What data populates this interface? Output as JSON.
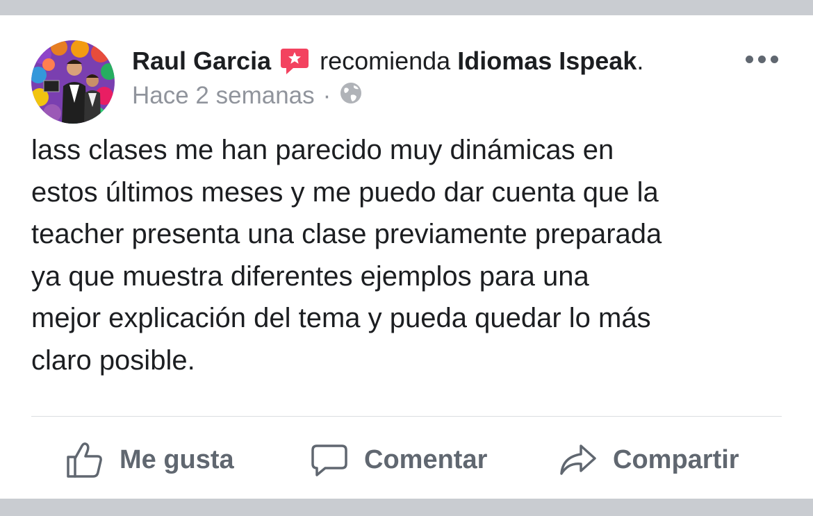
{
  "post": {
    "author": "Raul Garcia",
    "action_text": "recomienda",
    "page_name": "Idiomas Ispeak",
    "page_name_suffix": ".",
    "time_ago": "Hace 2 semanas",
    "separator": "·",
    "privacy_icon": "globe-icon",
    "recommend_icon": "recommendation-star-icon",
    "body": "lass clases me han parecido muy dinámicas en\nestos últimos meses y me puedo dar cuenta que la\nteacher presenta una clase previamente preparada\nya que muestra diferentes ejemplos para una\nmejor explicación del tema y pueda quedar lo más\nclaro posible."
  },
  "actions": {
    "like_label": "Me gusta",
    "comment_label": "Comentar",
    "share_label": "Compartir"
  },
  "colors": {
    "recommend_badge": "#f3425f",
    "secondary_text": "#90949c",
    "action_text": "#606770",
    "page_background": "#c9ccd1"
  }
}
